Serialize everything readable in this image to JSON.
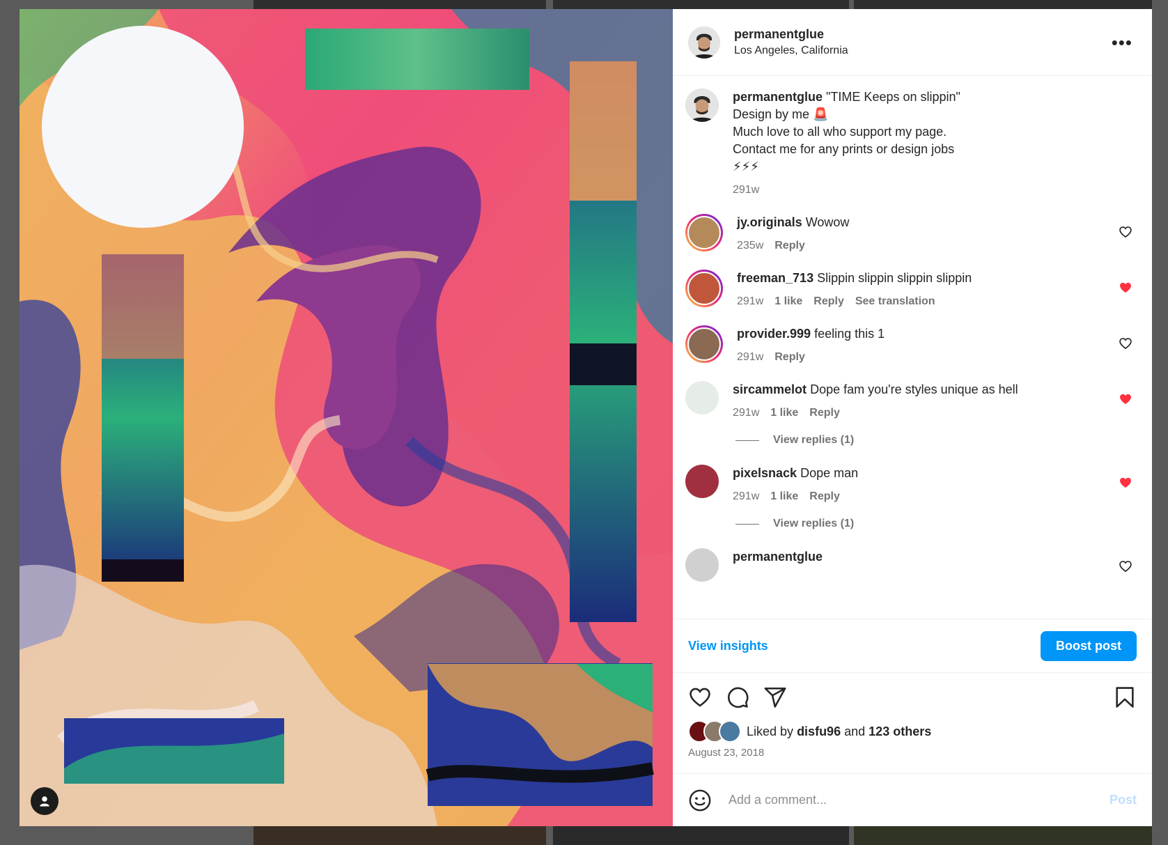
{
  "post": {
    "owner": {
      "username": "permanentglue",
      "location": "Los Angeles, California"
    },
    "more_icon": "more-horizontal-icon",
    "caption": {
      "username": "permanentglue",
      "lines": [
        "\"TIME Keeps on slippin\"",
        "Design by me 🚨",
        "Much love to all who support my page.",
        "Contact me for any prints or design jobs",
        "⚡⚡⚡"
      ],
      "time": "291w"
    },
    "comments": [
      {
        "username": "jy.originals",
        "text": "Wowow",
        "time": "235w",
        "likes": "",
        "reply": "Reply",
        "translate": "",
        "liked": false,
        "ring": true,
        "avatar_color": "#b58a5a"
      },
      {
        "username": "freeman_713",
        "text": "Slippin slippin slippin slippin",
        "time": "291w",
        "likes": "1 like",
        "reply": "Reply",
        "translate": "See translation",
        "liked": true,
        "ring": true,
        "avatar_color": "#c0573a"
      },
      {
        "username": "provider.999",
        "text": "feeling this 1",
        "time": "291w",
        "likes": "",
        "reply": "Reply",
        "translate": "",
        "liked": false,
        "ring": true,
        "avatar_color": "#8a6a52"
      },
      {
        "username": "sircammelot",
        "text": "Dope fam you're styles unique as hell",
        "time": "291w",
        "likes": "1 like",
        "reply": "Reply",
        "translate": "",
        "liked": true,
        "ring": false,
        "avatar_color": "#e6ece6",
        "replies": "View replies (1)"
      },
      {
        "username": "pixelsnack",
        "text": "Dope man",
        "time": "291w",
        "likes": "1 like",
        "reply": "Reply",
        "translate": "",
        "liked": true,
        "ring": false,
        "avatar_color": "#a03040",
        "replies": "View replies (1)"
      },
      {
        "username": "permanentglue",
        "text": "",
        "time": "",
        "likes": "",
        "reply": "",
        "translate": "",
        "liked": false,
        "ring": false,
        "avatar_color": "#d0d0d0"
      }
    ],
    "insights_label": "View insights",
    "boost_label": "Boost post",
    "likes": {
      "prefix": "Liked by",
      "user": "disfu96",
      "joiner": "and",
      "others": "123 others"
    },
    "date": "August 23, 2018",
    "comment_placeholder": "Add a comment...",
    "post_label": "Post",
    "colors": {
      "accent": "#0095f6",
      "liked": "#ff3040",
      "muted": "#737373"
    }
  }
}
